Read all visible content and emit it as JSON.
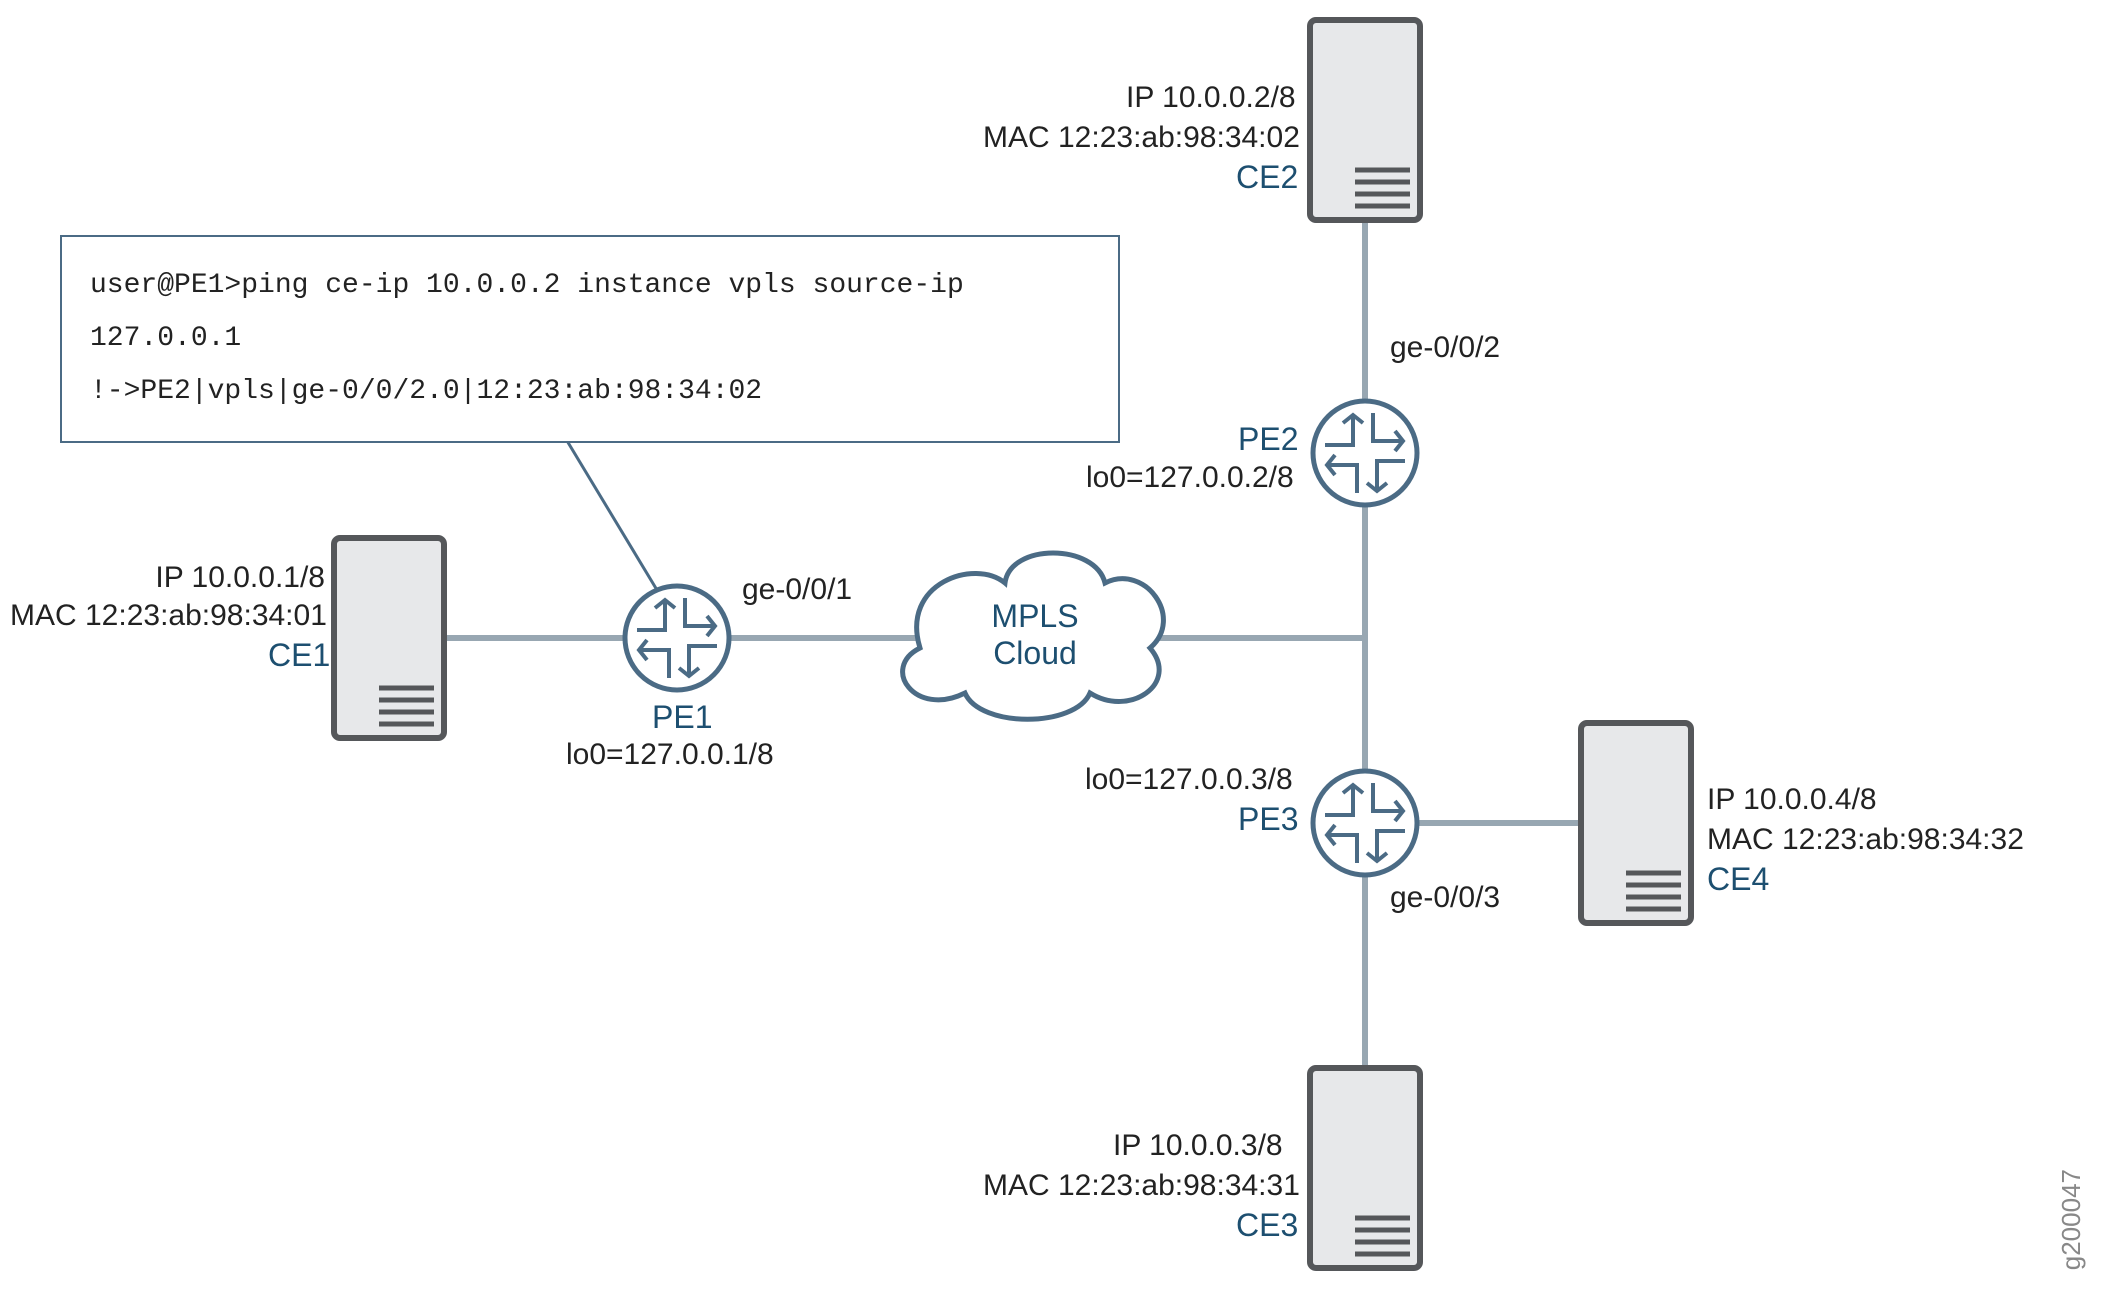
{
  "diagram_id": "g200047",
  "callout": {
    "line1": "user@PE1>ping ce-ip 10.0.0.2 instance vpls source-ip 127.0.0.1",
    "line2": "!->PE2|vpls|ge-0/0/2.0|12:23:ab:98:34:02"
  },
  "cloud_label_top": "MPLS",
  "cloud_label_bot": "Cloud",
  "nodes": {
    "CE1": {
      "name": "CE1",
      "ip": "IP 10.0.0.1/8",
      "mac": "MAC 12:23:ab:98:34:01"
    },
    "CE2": {
      "name": "CE2",
      "ip": "IP 10.0.0.2/8",
      "mac": "MAC 12:23:ab:98:34:02"
    },
    "CE3": {
      "name": "CE3",
      "ip": "IP 10.0.0.3/8",
      "mac": "MAC 12:23:ab:98:34:31"
    },
    "CE4": {
      "name": "CE4",
      "ip": "IP 10.0.0.4/8",
      "mac": "MAC 12:23:ab:98:34:32"
    },
    "PE1": {
      "name": "PE1",
      "lo": "lo0=127.0.0.1/8",
      "iface": "ge-0/0/1"
    },
    "PE2": {
      "name": "PE2",
      "lo": "lo0=127.0.0.2/8",
      "iface": "ge-0/0/2"
    },
    "PE3": {
      "name": "PE3",
      "lo": "lo0=127.0.0.3/8",
      "iface": "ge-0/0/3"
    }
  }
}
